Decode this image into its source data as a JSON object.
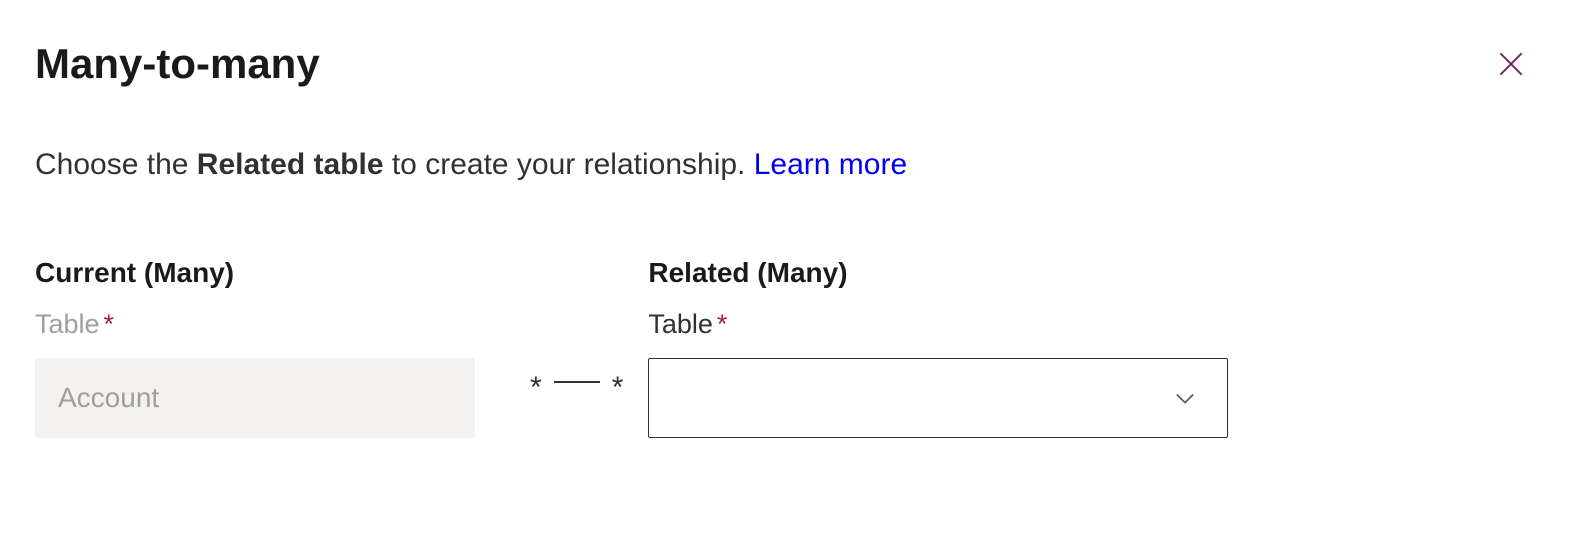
{
  "header": {
    "title": "Many-to-many"
  },
  "description": {
    "prefix": "Choose the ",
    "bold": "Related table",
    "suffix": " to create your relationship. ",
    "link": "Learn more"
  },
  "connector": {
    "left": "*",
    "right": "*"
  },
  "current": {
    "heading": "Current (Many)",
    "label": "Table",
    "value": "Account"
  },
  "related": {
    "heading": "Related (Many)",
    "label": "Table",
    "value": ""
  }
}
